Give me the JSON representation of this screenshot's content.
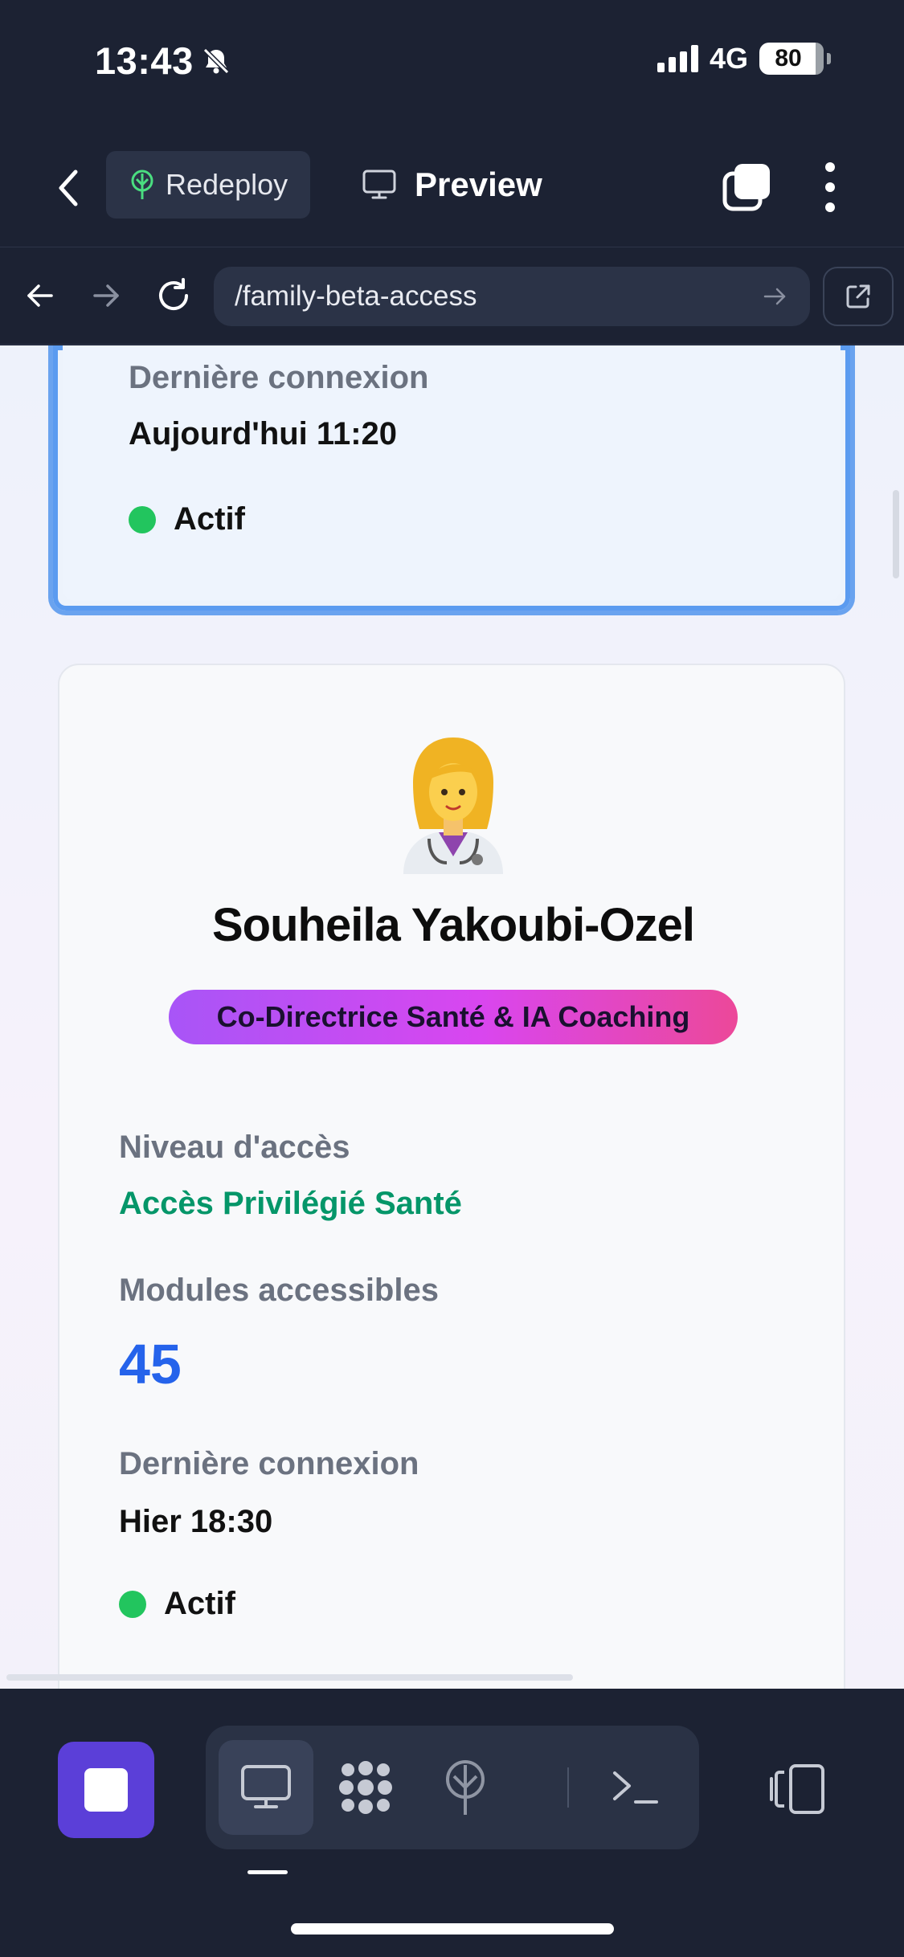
{
  "status_bar": {
    "time": "13:43",
    "network": "4G",
    "battery": "80"
  },
  "toolbar": {
    "redeploy_label": "Redeploy",
    "preview_label": "Preview"
  },
  "urlbar": {
    "url": "/family-beta-access"
  },
  "prev_card": {
    "last_login_label": "Dernière connexion",
    "last_login_value": "Aujourd'hui 11:20",
    "status": "Actif"
  },
  "member_card": {
    "avatar_emoji": "👩‍⚕️",
    "name": "Souheila Yakoubi-Ozel",
    "role": "Co-Directrice Santé & IA Coaching",
    "access_level_label": "Niveau d'accès",
    "access_level_value": "Accès Privilégié Santé",
    "modules_label": "Modules accessibles",
    "modules_value": "45",
    "last_login_label": "Dernière connexion",
    "last_login_value": "Hier 18:30",
    "status": "Actif"
  },
  "colors": {
    "status_active": "#22c55e",
    "access_green": "#059669",
    "modules_blue": "#2563eb",
    "stop_purple": "#5b3fd8"
  },
  "bottom_bar": {
    "icons": [
      "stop-icon",
      "desktop-icon",
      "grid-icon",
      "deploy-icon",
      "terminal-icon",
      "device-icon"
    ],
    "active_tool": "desktop-icon"
  }
}
